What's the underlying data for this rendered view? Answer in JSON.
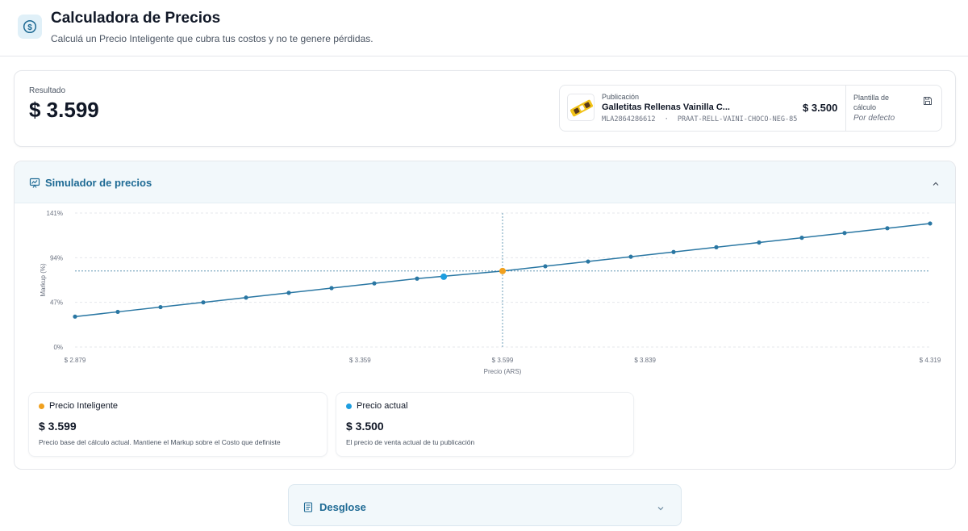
{
  "header": {
    "title": "Calculadora de Precios",
    "subtitle": "Calculá un Precio Inteligente que cubra tus costos y no te genere pérdidas.",
    "icon": "dollar-circle-icon"
  },
  "result": {
    "label": "Resultado",
    "value": "$ 3.599"
  },
  "publication": {
    "label": "Publicación",
    "title": "Galletitas Rellenas Vainilla C...",
    "id": "MLA2864286612",
    "separator": "·",
    "sku": "PRAAT-RELL-VAINI-CHOCO-NEG-85",
    "price": "$ 3.500",
    "template_label": "Plantilla de cálculo",
    "template_value": "Por defecto"
  },
  "simulator": {
    "title": "Simulador de precios",
    "icon": "presentation-chart-icon"
  },
  "chart_data": {
    "type": "line",
    "xlabel": "Precio (ARS)",
    "ylabel": "Markup (%)",
    "xlim": [
      2879,
      4319
    ],
    "ylim": [
      0,
      141
    ],
    "y_ticks": [
      "0%",
      "47%",
      "94%",
      "141%"
    ],
    "y_tick_values": [
      0,
      47,
      94,
      141
    ],
    "x_ticks": [
      "$ 2.879",
      "$ 3.359",
      "$ 3.599",
      "$ 3.839",
      "$ 4.319"
    ],
    "x_tick_values": [
      2879,
      3359,
      3599,
      3839,
      4319
    ],
    "grid": true,
    "series": [
      {
        "x": [
          2879,
          2951,
          3023,
          3095,
          3167,
          3239,
          3311,
          3383,
          3455,
          3599,
          3671,
          3743,
          3815,
          3887,
          3959,
          4031,
          4103,
          4175,
          4247,
          4319
        ],
        "y": [
          32,
          37,
          42,
          47,
          52,
          57,
          62,
          67,
          72,
          80,
          85,
          90,
          95,
          100,
          105,
          110,
          115,
          120,
          125,
          130
        ]
      }
    ],
    "markers": [
      {
        "name": "Precio Inteligente",
        "x": 3599,
        "y": 80,
        "color": "#f0a01e"
      },
      {
        "name": "Precio actual",
        "x": 3500,
        "y": 74,
        "color": "#1e9ee0"
      }
    ],
    "line_color": "#2a77a3",
    "grid_color": "#e5e7eb",
    "reference_line_color": "#1e6a94"
  },
  "cards": [
    {
      "name": "Precio Inteligente",
      "value": "$ 3.599",
      "desc": "Precio base del cálculo actual. Mantiene el Markup sobre el Costo que definiste",
      "color": "#f0a01e"
    },
    {
      "name": "Precio actual",
      "value": "$ 3.500",
      "desc": "El precio de venta actual de tu publicación",
      "color": "#1e9ee0"
    }
  ],
  "desglose": {
    "title": "Desglose",
    "icon": "document-icon"
  }
}
